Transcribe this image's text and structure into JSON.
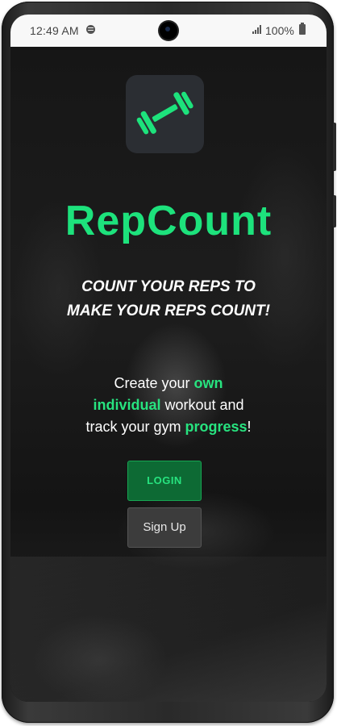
{
  "status_bar": {
    "time": "12:49 AM",
    "battery": "100%",
    "icons": [
      "spotify-icon",
      "signal-icon",
      "battery-icon"
    ]
  },
  "app": {
    "name": "RepCount",
    "logo_icon": "dumbbell-icon",
    "accent_color": "#1de27c"
  },
  "slogan": {
    "line1": "COUNT YOUR REPS TO",
    "line2": "MAKE YOUR REPS COUNT!"
  },
  "description": {
    "part1": "Create your ",
    "highlight1": "own",
    "highlight2": "individual",
    "part2": " workout and",
    "part3": "track your gym ",
    "highlight3": "progress",
    "part4": "!"
  },
  "buttons": {
    "login": "LOGIN",
    "signup": "Sign Up"
  }
}
